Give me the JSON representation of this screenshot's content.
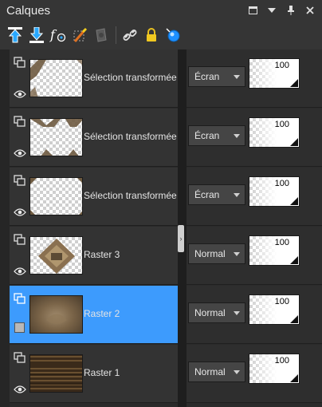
{
  "panel": {
    "title": "Calques"
  },
  "window_controls": [
    "restore-icon",
    "dropdown-icon",
    "pin-icon",
    "close-icon"
  ],
  "toolbar": {
    "buttons": [
      {
        "icon": "move-layer-up-icon"
      },
      {
        "icon": "move-layer-down-icon"
      },
      {
        "icon": "layer-effects-icon"
      },
      {
        "icon": "edit-selection-icon"
      },
      {
        "icon": "mask-icon"
      },
      {
        "icon": "link-icon"
      },
      {
        "icon": "lock-icon"
      },
      {
        "icon": "highlight-icon"
      }
    ]
  },
  "layers": [
    {
      "name": "Sélection transformée",
      "blend_mode": "Écran",
      "opacity": "100",
      "selected": false,
      "visible": true
    },
    {
      "name": "Sélection transformée",
      "blend_mode": "Écran",
      "opacity": "100",
      "selected": false,
      "visible": true
    },
    {
      "name": "Sélection transformée",
      "blend_mode": "Écran",
      "opacity": "100",
      "selected": false,
      "visible": true
    },
    {
      "name": "Raster 3",
      "blend_mode": "Normal",
      "opacity": "100",
      "selected": false,
      "visible": true
    },
    {
      "name": "Raster 2",
      "blend_mode": "Normal",
      "opacity": "100",
      "selected": true,
      "visible": false
    },
    {
      "name": "Raster 1",
      "blend_mode": "Normal",
      "opacity": "100",
      "selected": false,
      "visible": true
    }
  ],
  "colors": {
    "selection": "#3d9bfd",
    "accent": "#1e90ff"
  }
}
